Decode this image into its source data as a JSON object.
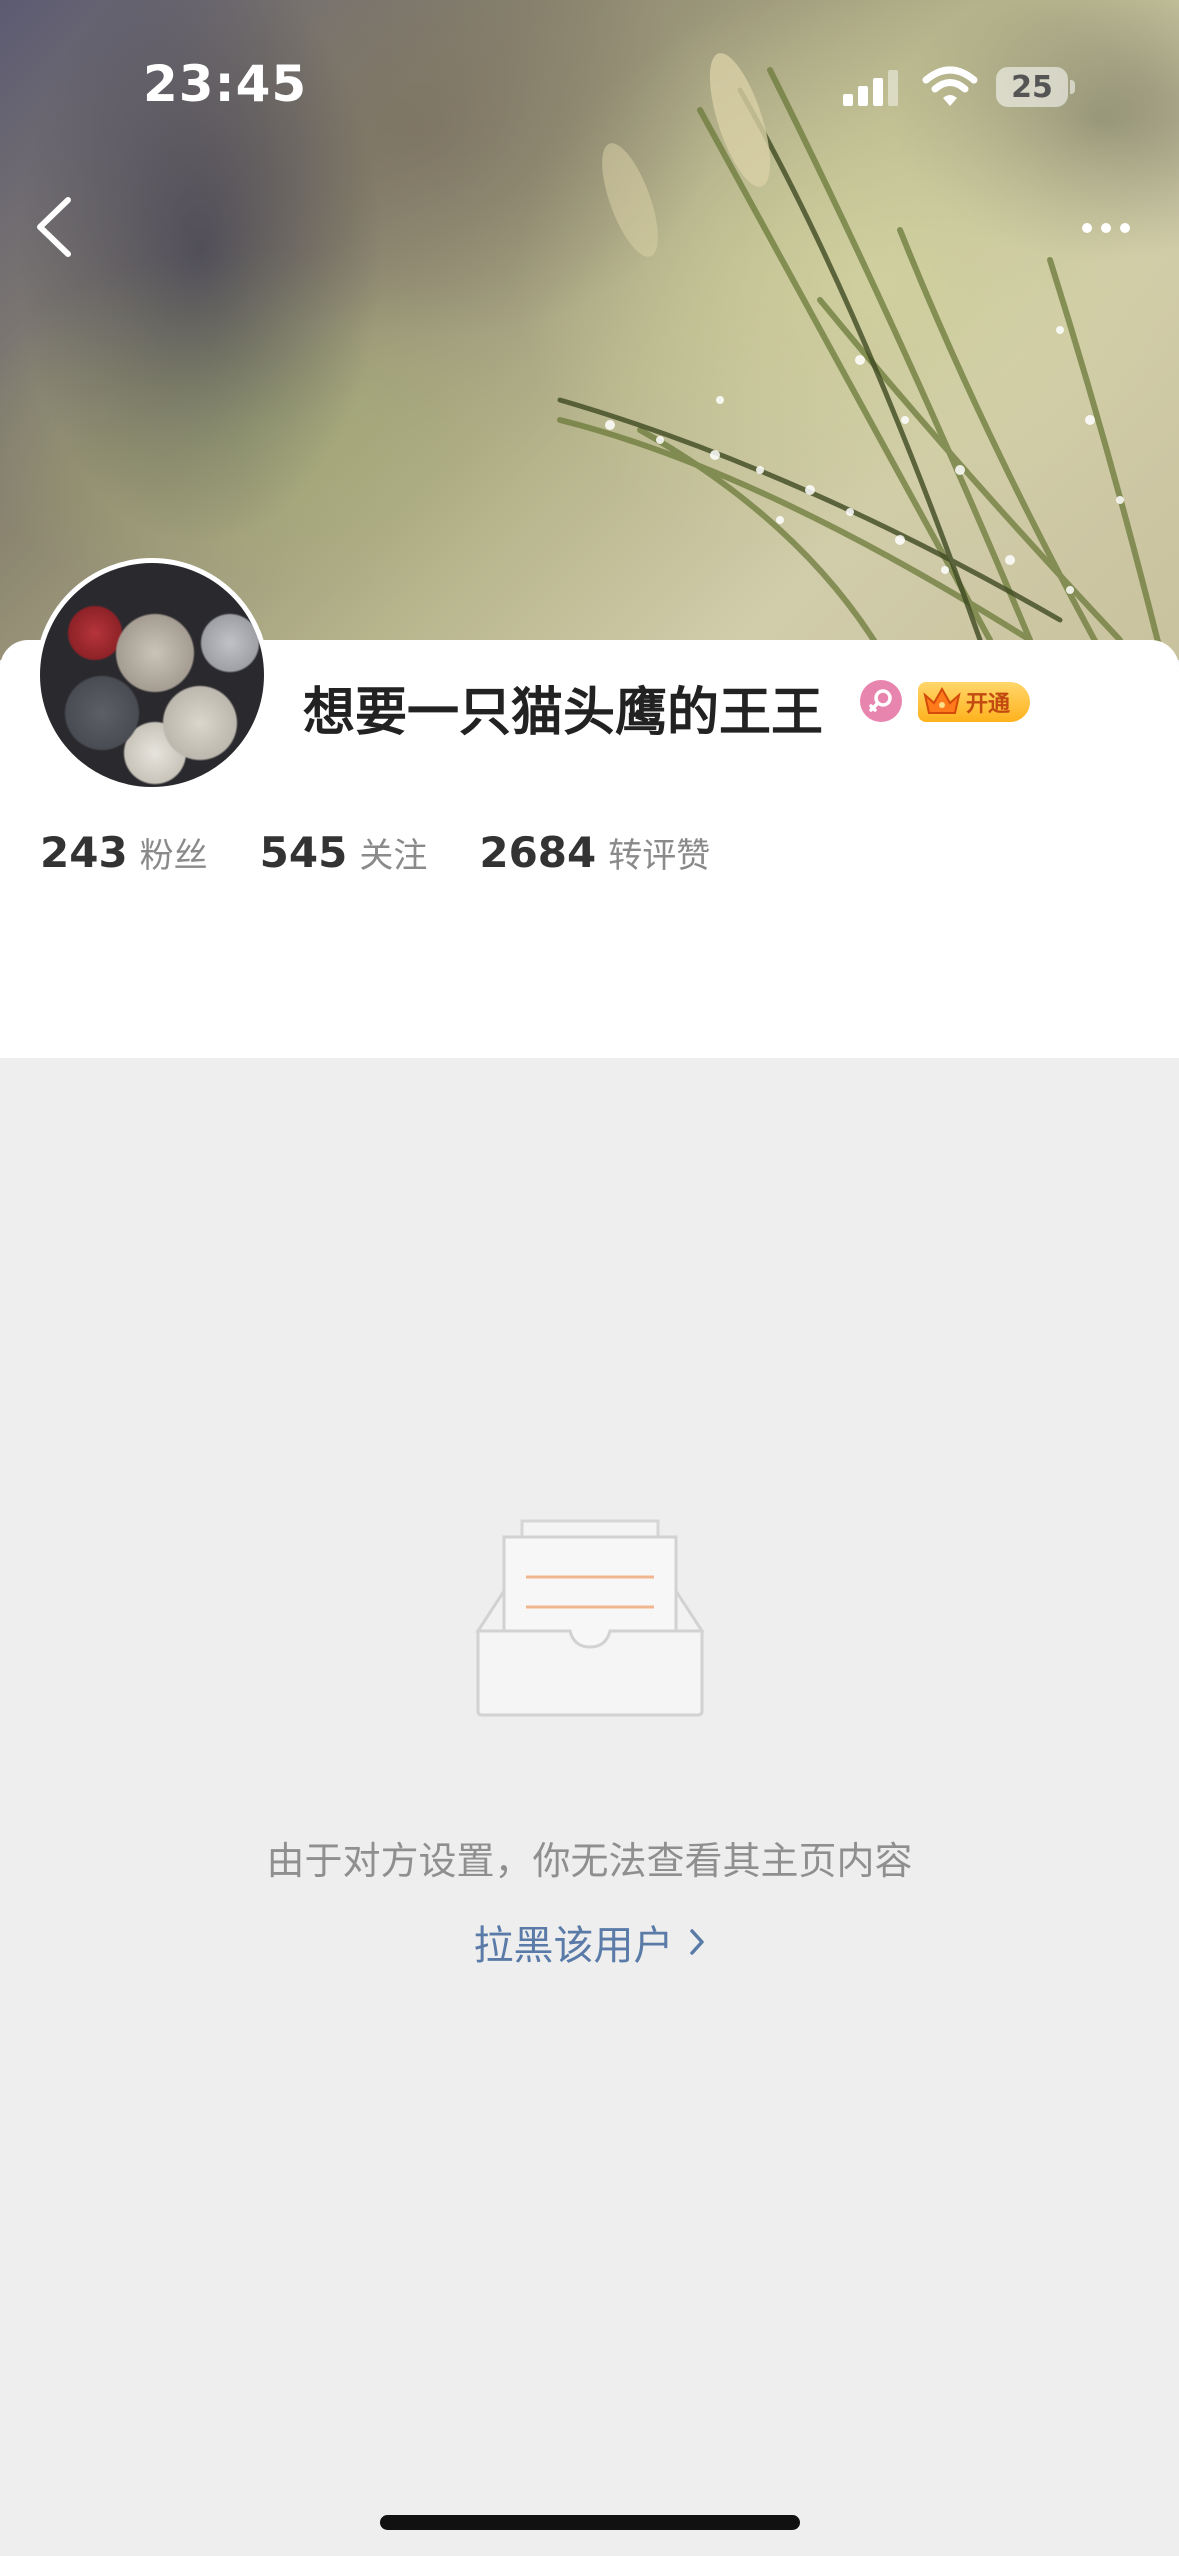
{
  "status_bar": {
    "time": "23:45",
    "battery_level": "25"
  },
  "navigation": {
    "back_icon": "chevron-left-icon",
    "more_icon": "more-dots-icon"
  },
  "profile": {
    "username": "想要一只猫头鹰的王王",
    "gender_icon": "female-icon",
    "vip_badge_label": "开通",
    "stats": [
      {
        "value": "243",
        "label": "粉丝"
      },
      {
        "value": "545",
        "label": "关注"
      },
      {
        "value": "2684",
        "label": "转评赞"
      }
    ]
  },
  "content": {
    "empty_icon": "empty-inbox-icon",
    "notice": "由于对方设置，你无法查看其主页内容",
    "block_link": "拉黑该用户"
  },
  "colors": {
    "background": "#eeeeee",
    "card": "#ffffff",
    "link": "#5a7ba8",
    "gender_badge": "#e885ae",
    "vip_gold": "#ffb21c"
  }
}
